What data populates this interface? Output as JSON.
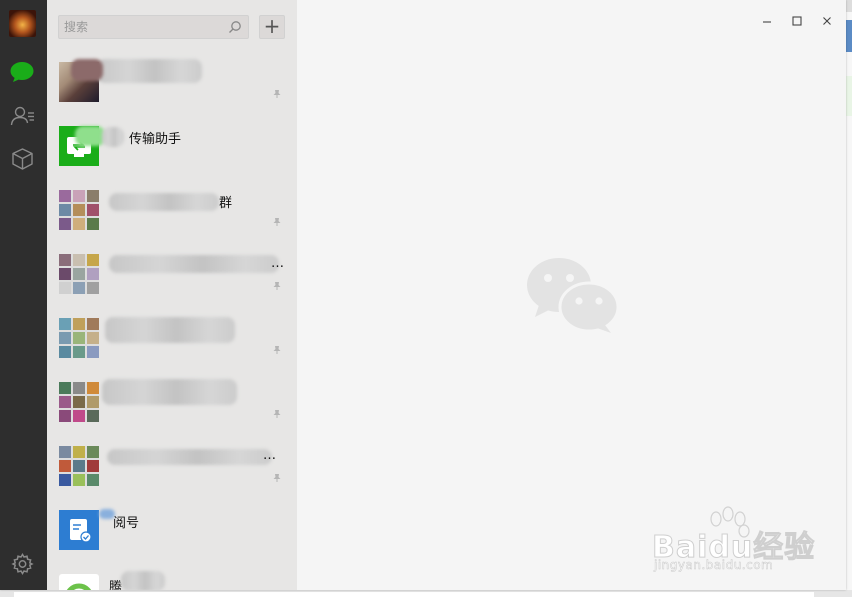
{
  "sidebar": {
    "icons": [
      "avatar",
      "chat-icon",
      "contacts-icon",
      "favorites-icon",
      "settings-icon"
    ],
    "active_color": "#1aad19"
  },
  "search": {
    "placeholder": "搜索",
    "icon": "search-icon"
  },
  "add_button": {
    "label": "+"
  },
  "chats": [
    {
      "name": "",
      "pinned": true
    },
    {
      "name": "传输助手",
      "pinned": false
    },
    {
      "name": "群",
      "pinned": true
    },
    {
      "name": "…",
      "pinned": true
    },
    {
      "name": "",
      "pinned": true
    },
    {
      "name": "",
      "pinned": true
    },
    {
      "name": "…",
      "pinned": true
    },
    {
      "name": "阅号",
      "pinned": false
    },
    {
      "name": "腾",
      "pinned": false
    }
  ],
  "window_controls": [
    "minimize-icon",
    "maximize-icon",
    "close-icon"
  ],
  "watermark": {
    "text": "Baidu经验",
    "url": "jingyan.baidu.com"
  },
  "colors": {
    "sidebar_bg": "#2e2e2e",
    "list_bg": "#e7e6e5",
    "main_bg": "#f5f5f5",
    "green": "#1aad19",
    "blue": "#2d7dd2"
  }
}
